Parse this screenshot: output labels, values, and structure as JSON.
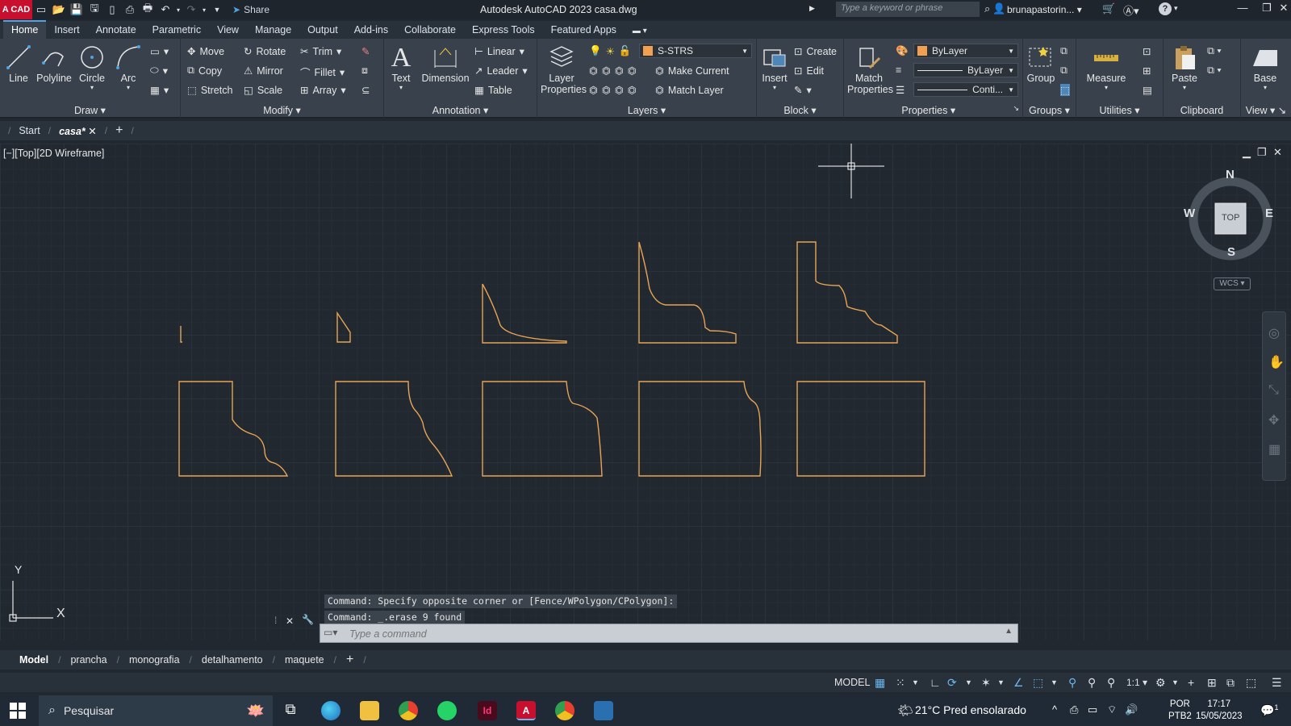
{
  "titlebar": {
    "logo": "A CAD",
    "share_label": "Share",
    "title": "Autodesk AutoCAD 2023   casa.dwg",
    "search_placeholder": "Type a keyword or phrase",
    "user": "brunapastorin...",
    "help": "?"
  },
  "ribbon_tabs": [
    "Home",
    "Insert",
    "Annotate",
    "Parametric",
    "View",
    "Manage",
    "Output",
    "Add-ins",
    "Collaborate",
    "Express Tools",
    "Featured Apps"
  ],
  "ribbon": {
    "draw": {
      "title": "Draw",
      "line": "Line",
      "polyline": "Polyline",
      "circle": "Circle",
      "arc": "Arc"
    },
    "modify": {
      "title": "Modify",
      "move": "Move",
      "rotate": "Rotate",
      "trim": "Trim",
      "copy": "Copy",
      "mirror": "Mirror",
      "fillet": "Fillet",
      "stretch": "Stretch",
      "scale": "Scale",
      "array": "Array"
    },
    "annotation": {
      "title": "Annotation",
      "text": "Text",
      "dimension": "Dimension",
      "linear": "Linear",
      "leader": "Leader",
      "table": "Table"
    },
    "layers": {
      "title": "Layers",
      "layer_properties": "Layer Properties",
      "current_layer": "S-STRS",
      "make_current": "Make Current",
      "match_layer": "Match Layer"
    },
    "block": {
      "title": "Block",
      "insert": "Insert",
      "create": "Create",
      "edit": "Edit"
    },
    "properties": {
      "title": "Properties",
      "match_properties": "Match Properties",
      "color": "ByLayer",
      "lineweight": "ByLayer",
      "linetype": "Conti..."
    },
    "groups": {
      "title": "Groups",
      "group": "Group"
    },
    "utilities": {
      "title": "Utilities",
      "measure": "Measure"
    },
    "clipboard": {
      "title": "Clipboard",
      "paste": "Paste"
    },
    "view": {
      "title": "View",
      "base": "Base"
    }
  },
  "file_tabs": {
    "start": "Start",
    "current": "casa*"
  },
  "viewport": {
    "label": "[−][Top][2D Wireframe]",
    "compass": {
      "n": "N",
      "s": "S",
      "e": "E",
      "w": "W",
      "top": "TOP"
    },
    "wcs": "WCS",
    "ucs": {
      "y": "Y",
      "x": "X"
    }
  },
  "command": {
    "history": [
      "Command: Specify opposite corner or [Fence/WPolygon/CPolygon]:",
      "Command: _.erase 9 found"
    ],
    "placeholder": "Type a command"
  },
  "layout_tabs": [
    "Model",
    "prancha",
    "monografia",
    "detalhamento",
    "maquete"
  ],
  "status": {
    "model": "MODEL",
    "scale": "1:1"
  },
  "taskbar": {
    "search": "Pesquisar",
    "weather": "21°C  Pred ensolarado",
    "lang1": "POR",
    "lang2": "PTB2",
    "time": "17:17",
    "date": "15/05/2023",
    "notifications": "1"
  },
  "colors": {
    "accent": "#4fa3e0",
    "drawing_line": "#e8a454",
    "layer_swatch": "#f0a050"
  }
}
